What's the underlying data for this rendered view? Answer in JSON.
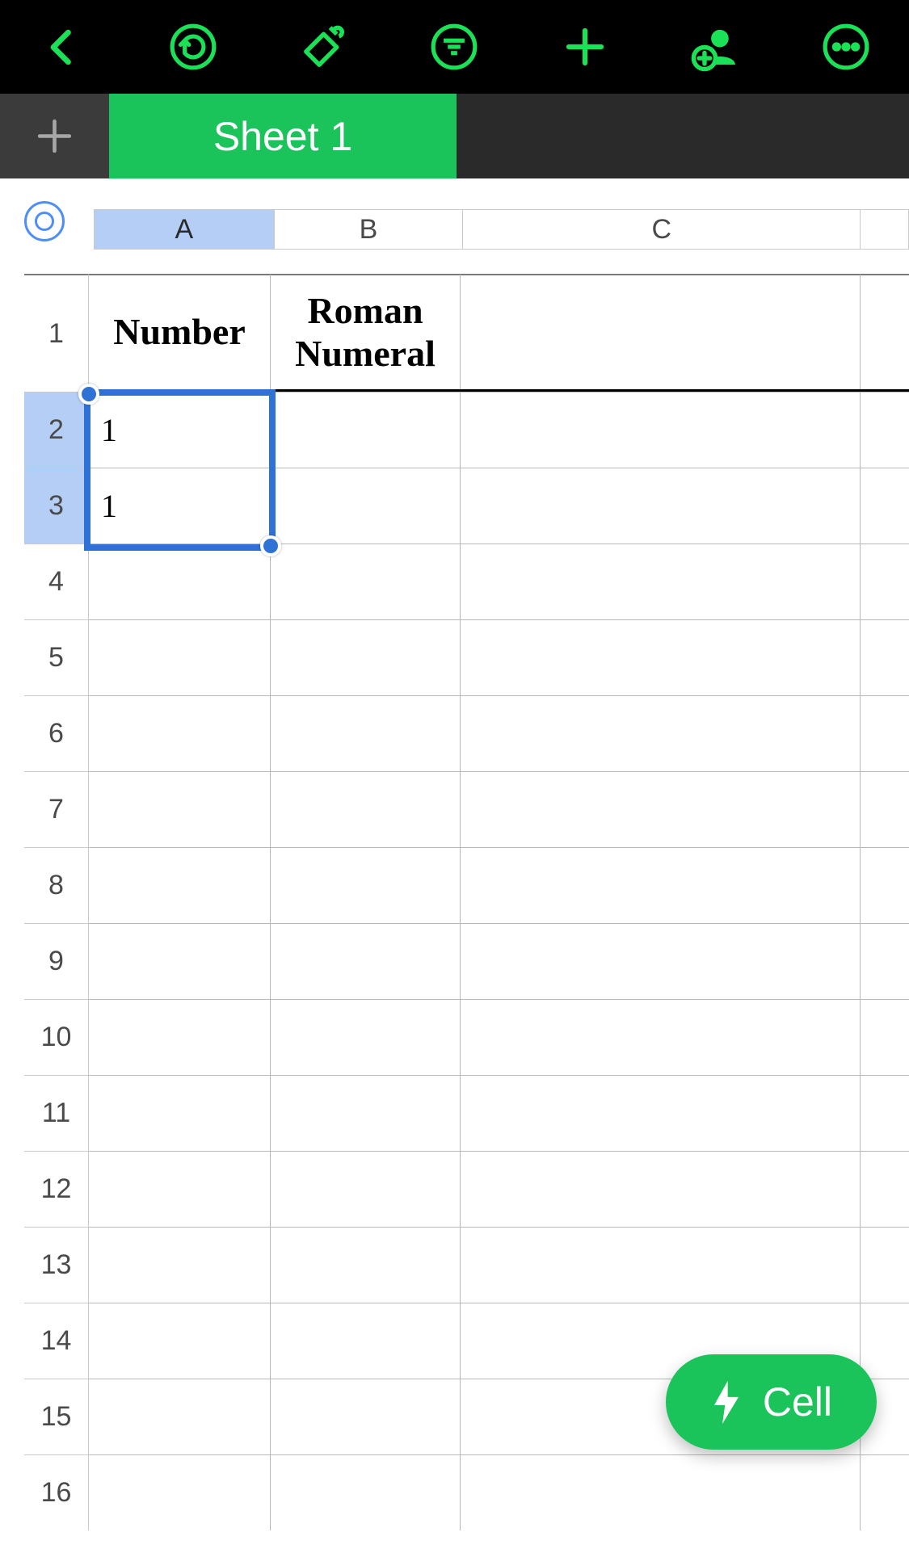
{
  "toolbar": {
    "back": "back",
    "undo": "undo",
    "format": "format-paint",
    "filter": "filter",
    "insert": "insert",
    "share": "add-person",
    "more": "more"
  },
  "tabs": {
    "active": "Sheet 1"
  },
  "columns": [
    "A",
    "B",
    "C",
    ""
  ],
  "rows": [
    "1",
    "2",
    "3",
    "4",
    "5",
    "6",
    "7",
    "8",
    "9",
    "10",
    "11",
    "12",
    "13",
    "14",
    "15",
    "16"
  ],
  "cells": {
    "A1": "Number",
    "B1": "Roman Numeral",
    "A2": "1",
    "A3": "1"
  },
  "selection": {
    "range": "A2:A3"
  },
  "fab": {
    "label": "Cell"
  }
}
